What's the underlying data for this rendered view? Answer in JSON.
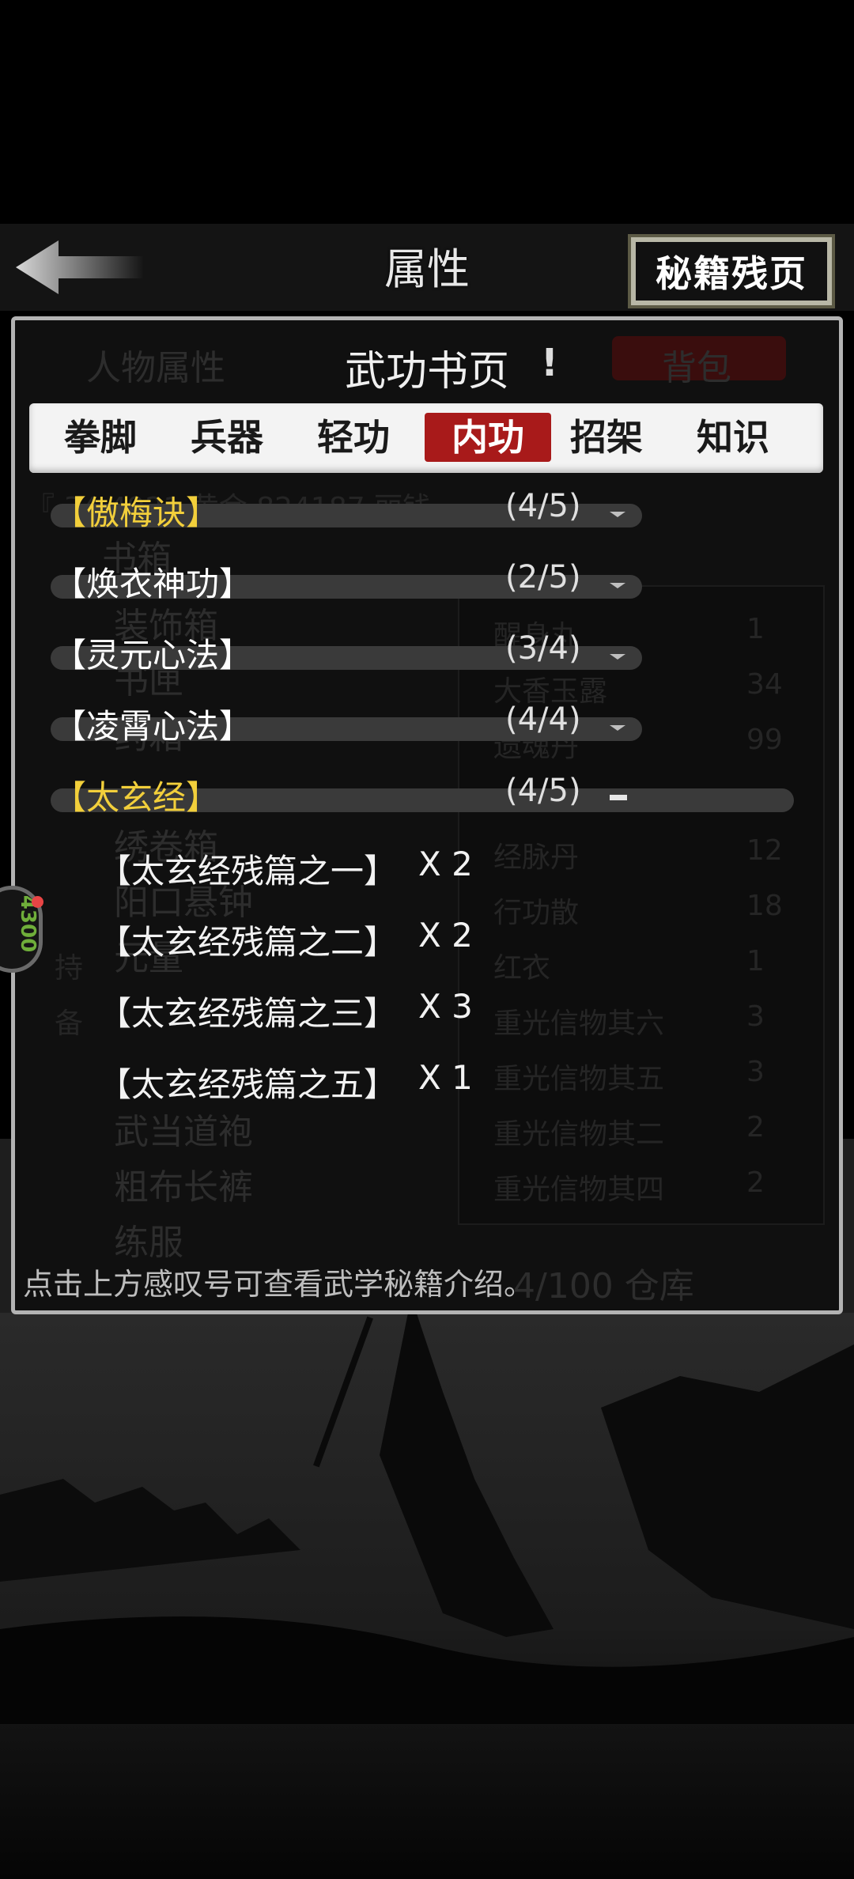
{
  "header": {
    "title": "属性",
    "scroll_button": "秘籍残页"
  },
  "background_tabs": {
    "left": "人物属性",
    "right": "背包"
  },
  "section": {
    "title": "武功书页",
    "info_mark": "!"
  },
  "tabs": [
    {
      "label": "拳脚",
      "active": false
    },
    {
      "label": "兵器",
      "active": false
    },
    {
      "label": "轻功",
      "active": false
    },
    {
      "label": "内功",
      "active": true
    },
    {
      "label": "招架",
      "active": false
    },
    {
      "label": "知识",
      "active": false
    }
  ],
  "skills": [
    {
      "name": "【傲梅诀】",
      "count": "(4/5)",
      "gold": true,
      "expanded": false
    },
    {
      "name": "【焕衣神功】",
      "count": "(2/5)",
      "gold": false,
      "expanded": false
    },
    {
      "name": "【灵元心法】",
      "count": "(3/4)",
      "gold": false,
      "expanded": false
    },
    {
      "name": "【凌霄心法】",
      "count": "(4/4)",
      "gold": false,
      "expanded": false
    },
    {
      "name": "【太玄经】",
      "count": "(4/5)",
      "gold": true,
      "expanded": true
    }
  ],
  "fragments": [
    {
      "name": "【太玄经残篇之一】",
      "qty": "X 2"
    },
    {
      "name": "【太玄经残篇之二】",
      "qty": "X 2"
    },
    {
      "name": "【太玄经残篇之三】",
      "qty": "X 3"
    },
    {
      "name": "【太玄经残篇之五】",
      "qty": "X 1"
    }
  ],
  "hint": "点击上方感叹号可查看武学秘籍介绍。",
  "ghost_text": {
    "money_line": "『   34   4921   黄金   824187   丽钱",
    "left_items": [
      "书箱",
      "装饰箱",
      "书匣",
      "药箱",
      "绣卷箱",
      "阳口悬钟",
      "元量",
      "武当道袍",
      "粗布长裤",
      "练服"
    ],
    "left_marks": [
      "持",
      "备"
    ],
    "right_items": [
      {
        "name": "醒身丸",
        "qty": "1"
      },
      {
        "name": "大香玉露",
        "qty": "34"
      },
      {
        "name": "遗魂丹",
        "qty": "99"
      },
      {
        "name": "经脉丹",
        "qty": "12"
      },
      {
        "name": "行功散",
        "qty": "18"
      },
      {
        "name": "红衣",
        "qty": "1"
      },
      {
        "name": "重光信物其六",
        "qty": "3"
      },
      {
        "name": "重光信物其五",
        "qty": "3"
      },
      {
        "name": "重光信物其二",
        "qty": "2"
      },
      {
        "name": "重光信物其四",
        "qty": "2"
      }
    ],
    "storage": "4/100 仓库"
  },
  "float_button": {
    "label": "4300"
  },
  "colors": {
    "accent_red": "#a81a1a",
    "gold": "#f2cf3b",
    "panel_border": "#b3b3b3"
  }
}
